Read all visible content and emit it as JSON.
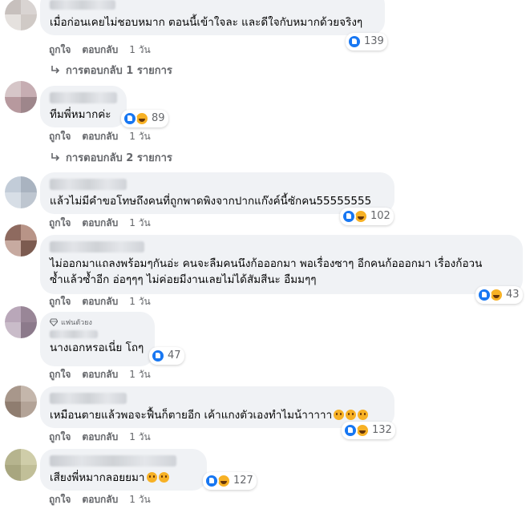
{
  "comments": [
    {
      "text": "เมื่อก่อนเคยไม่ชอบหมาก ตอนนี้เข้าใจละ และดีใจกับหมากด้วยจริงๆ",
      "reaction_count": "139",
      "reactions": [
        "like"
      ],
      "like_label": "ถูกใจ",
      "reply_label": "ตอบกลับ",
      "time": "1 วัน",
      "replies_link": "การตอบกลับ 1 รายการ",
      "avatar_colors": [
        "#c7c0bd",
        "#d9d4d2",
        "#e5e1de",
        "#d0cac6"
      ]
    },
    {
      "text": "ทีมพี่หมากค่ะ",
      "reaction_count": "89",
      "reactions": [
        "like",
        "haha"
      ],
      "like_label": "ถูกใจ",
      "reply_label": "ตอบกลับ",
      "time": "1 วัน",
      "replies_link": "การตอบกลับ 2 รายการ",
      "avatar_colors": [
        "#d6c6c8",
        "#c6adb2",
        "#b7999e",
        "#9e868b"
      ]
    },
    {
      "text": "แล้วไม่มีคำขอโทษถึงคนที่ถูกพาดพิงจากปากแก๊งค์นี้ซักคน55555555",
      "reaction_count": "102",
      "reactions": [
        "like",
        "haha"
      ],
      "like_label": "ถูกใจ",
      "reply_label": "ตอบกลับ",
      "time": "1 วัน",
      "avatar_colors": [
        "#c2ccd8",
        "#a9b3c0",
        "#d7dee6",
        "#bec6d0"
      ]
    },
    {
      "text": "ไม่ออกมาแถลงพร้อมๆกันอ่ะ คนจะลืมคนนึงก้อออกมา พอเรื่องซาๆ อีกคนก้อออกมา เรื่องก้อวน\nซ้ำแล้วซ้ำอีก อ่อๆๆๆ ไม่ค่อยมีงานเลยไม่ได้สัมสีนะ อืมมๆๆ",
      "reaction_count": "43",
      "reactions": [
        "like",
        "haha"
      ],
      "like_label": "ถูกใจ",
      "reply_label": "ตอบกลับ",
      "time": "1 วัน",
      "avatar_colors": [
        "#8e6a5f",
        "#b89487",
        "#c7aaa0",
        "#7c5b50"
      ]
    },
    {
      "fan_badge": "แฟนตัวยง",
      "text": "นางเอกหรอเนี่ย โถๆ",
      "reaction_count": "47",
      "reactions": [
        "like"
      ],
      "like_label": "ถูกใจ",
      "reply_label": "ตอบกลับ",
      "time": "1 วัน",
      "avatar_colors": [
        "#b9a7b9",
        "#998697",
        "#c9bcc9",
        "#8c7a8b"
      ]
    },
    {
      "text": "เหมือนตายแล้วพอจะฟื้นก็ตายอีก เค้าแกงตัวเองทำไมน้าาาาา",
      "text_emoji_count": 3,
      "reaction_count": "132",
      "reactions": [
        "like",
        "haha"
      ],
      "like_label": "ถูกใจ",
      "reply_label": "ตอบกลับ",
      "time": "1 วัน",
      "avatar_colors": [
        "#a8978b",
        "#c4b6ab",
        "#8f7d70",
        "#b3a397"
      ]
    },
    {
      "text": "เสียงพี่หมากลอยยมา",
      "text_emoji_count": 2,
      "reaction_count": "127",
      "reactions": [
        "like",
        "haha"
      ],
      "like_label": "ถูกใจ",
      "reply_label": "ตอบกลับ",
      "time": "1 วัน",
      "avatar_colors": [
        "#b6b48e",
        "#cfcda9",
        "#a8a67f",
        "#c1bf98"
      ]
    }
  ],
  "colors": {
    "bubble": "#f0f2f5",
    "text": "#050505",
    "muted": "#65676b",
    "like_blue": "#1877f2",
    "haha_yellow": "#f7b125"
  }
}
